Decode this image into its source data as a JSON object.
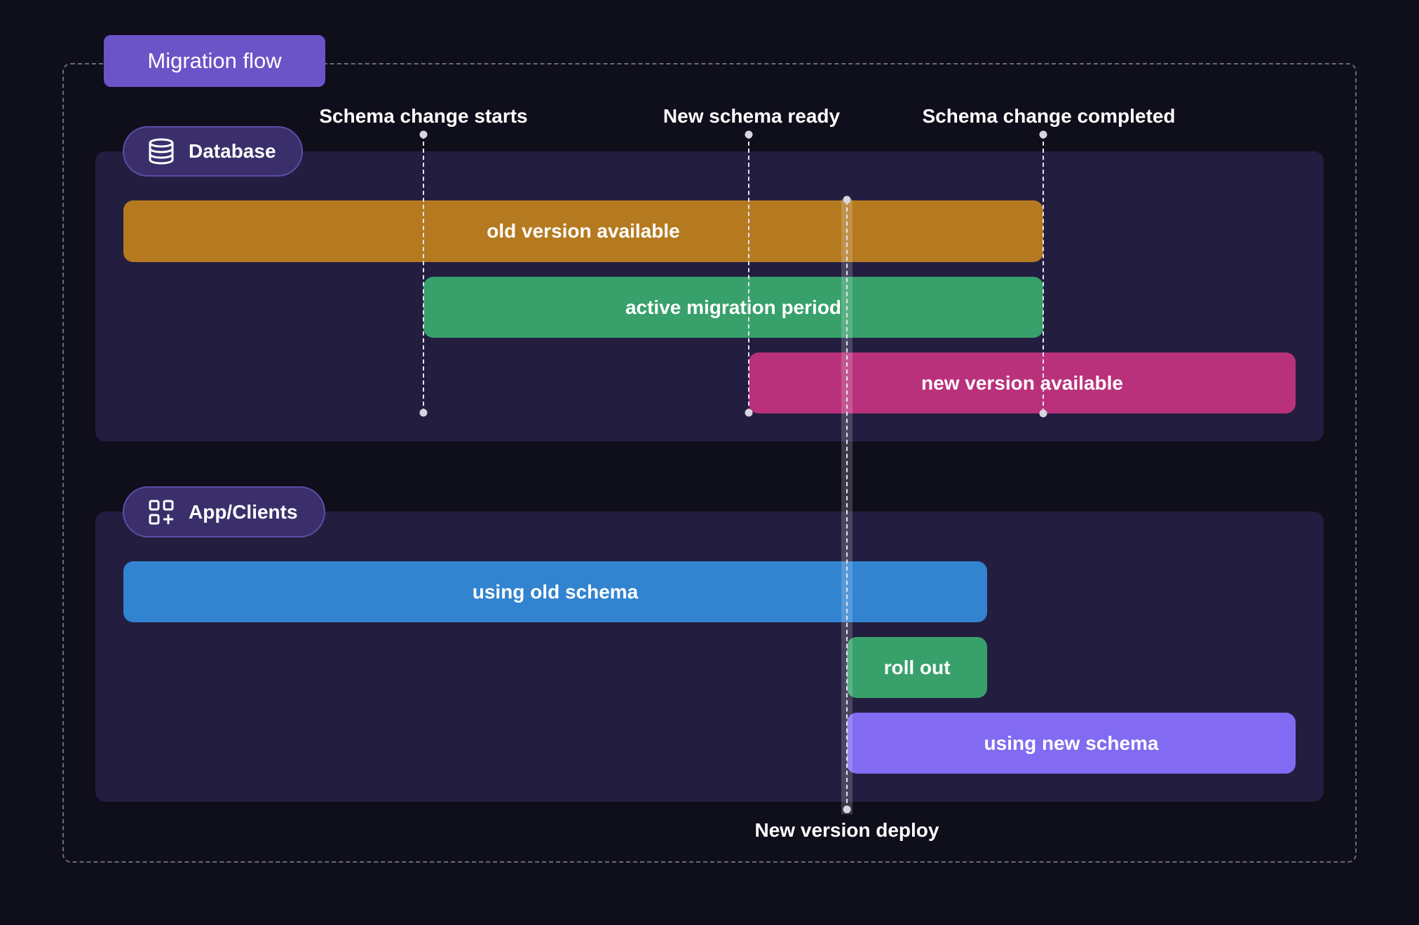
{
  "title": "Migration flow",
  "sections": {
    "database": {
      "label": "Database",
      "icon": "database-icon"
    },
    "app": {
      "label": "App/Clients",
      "icon": "apps-add-icon"
    }
  },
  "markers": [
    {
      "label": "Schema change starts"
    },
    {
      "label": "New schema ready"
    },
    {
      "label": "Schema change completed"
    }
  ],
  "deploy": {
    "label": "New version deploy"
  },
  "bars": {
    "database": [
      {
        "label": "old version available",
        "color": "#b57a20"
      },
      {
        "label": "active migration period",
        "color": "#38a16b"
      },
      {
        "label": "new version available",
        "color": "#b9317b"
      }
    ],
    "app": [
      {
        "label": "using old schema",
        "color": "#3283d0"
      },
      {
        "label": "roll out",
        "color": "#38a16b"
      },
      {
        "label": "using new schema",
        "color": "#826bf2"
      }
    ]
  },
  "colors": {
    "background": "#0f0e1b",
    "panel": "#231e40",
    "title_pill": "#6b54c8"
  }
}
